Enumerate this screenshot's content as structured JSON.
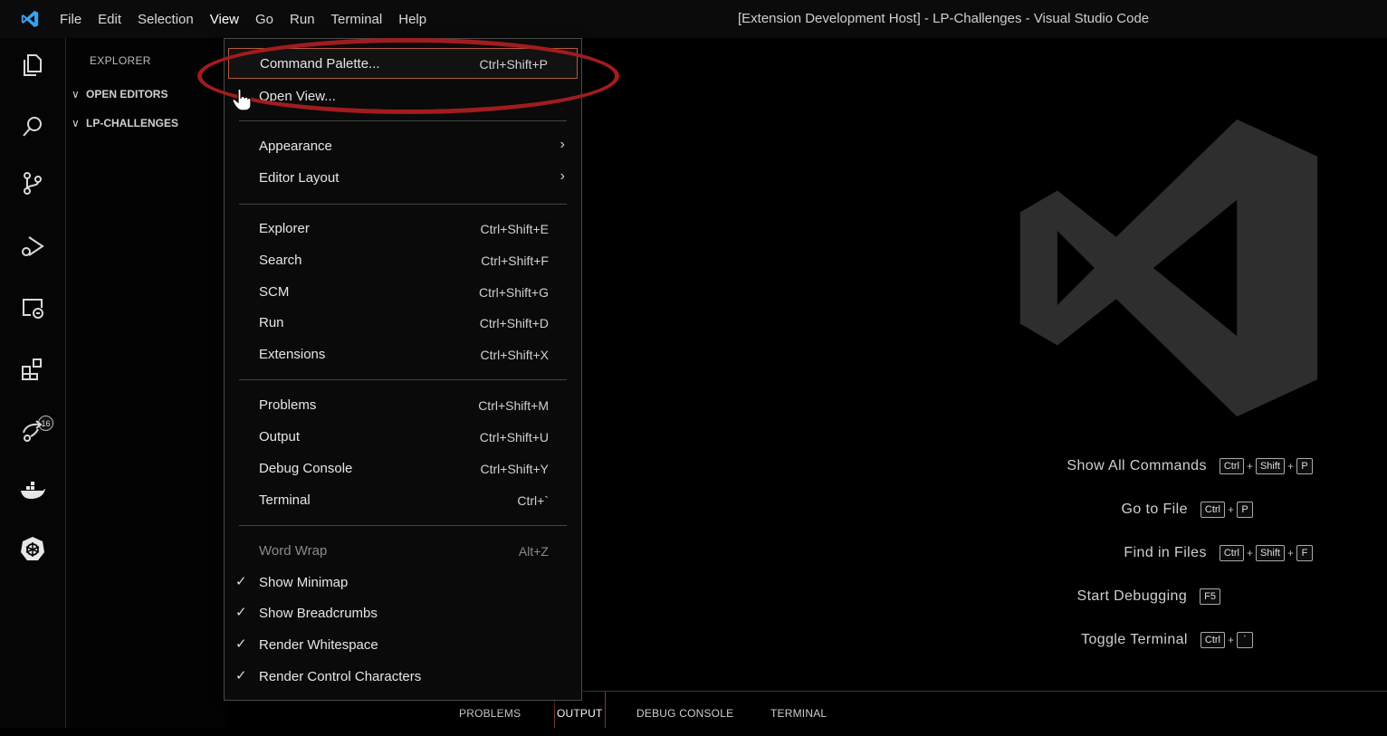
{
  "window": {
    "title": "[Extension Development Host] - LP-Challenges - Visual Studio Code"
  },
  "menubar": {
    "items": [
      "File",
      "Edit",
      "Selection",
      "View",
      "Go",
      "Run",
      "Terminal",
      "Help"
    ]
  },
  "activity_bar": {
    "icons": [
      "explorer-icon",
      "search-icon",
      "source-control-icon",
      "run-debug-icon",
      "remote-explorer-icon",
      "extensions-icon",
      "live-share-icon",
      "docker-icon",
      "kubernetes-icon"
    ],
    "extensions_badge": "16"
  },
  "sidebar": {
    "title": "EXPLORER",
    "sections": [
      "OPEN EDITORS",
      "LP-CHALLENGES"
    ]
  },
  "view_menu": {
    "command_palette": {
      "label": "Command Palette...",
      "key": "Ctrl+Shift+P"
    },
    "open_view": {
      "label": "Open View..."
    },
    "appearance": {
      "label": "Appearance"
    },
    "editor_layout": {
      "label": "Editor Layout"
    },
    "explorer": {
      "label": "Explorer",
      "key": "Ctrl+Shift+E"
    },
    "search": {
      "label": "Search",
      "key": "Ctrl+Shift+F"
    },
    "scm": {
      "label": "SCM",
      "key": "Ctrl+Shift+G"
    },
    "run": {
      "label": "Run",
      "key": "Ctrl+Shift+D"
    },
    "extensions": {
      "label": "Extensions",
      "key": "Ctrl+Shift+X"
    },
    "problems": {
      "label": "Problems",
      "key": "Ctrl+Shift+M"
    },
    "output": {
      "label": "Output",
      "key": "Ctrl+Shift+U"
    },
    "debug_console": {
      "label": "Debug Console",
      "key": "Ctrl+Shift+Y"
    },
    "terminal": {
      "label": "Terminal",
      "key": "Ctrl+`"
    },
    "word_wrap": {
      "label": "Word Wrap",
      "key": "Alt+Z"
    },
    "show_minimap": {
      "label": "Show Minimap",
      "checked": true
    },
    "show_breadcrumbs": {
      "label": "Show Breadcrumbs",
      "checked": true
    },
    "render_whitespace": {
      "label": "Render Whitespace",
      "checked": true
    },
    "render_control_characters": {
      "label": "Render Control Characters",
      "checked": true
    },
    "check_glyph": "✓",
    "submenu_glyph": "›"
  },
  "welcome_shortcuts": {
    "show_all_commands": {
      "label": "Show All Commands",
      "keys": [
        "Ctrl",
        "Shift",
        "P"
      ]
    },
    "go_to_file": {
      "label": "Go to File",
      "keys": [
        "Ctrl",
        "P"
      ]
    },
    "find_in_files": {
      "label": "Find in Files",
      "keys": [
        "Ctrl",
        "Shift",
        "F"
      ]
    },
    "start_debugging": {
      "label": "Start Debugging",
      "keys": [
        "F5"
      ]
    },
    "toggle_terminal": {
      "label": "Toggle Terminal",
      "keys": [
        "Ctrl",
        "`"
      ]
    },
    "plus": "+"
  },
  "panel": {
    "tabs": [
      "PROBLEMS",
      "OUTPUT",
      "DEBUG CONSOLE",
      "TERMINAL"
    ],
    "active_tab": "OUTPUT"
  },
  "colors": {
    "annotation_ellipse": "#a11c1e",
    "menu_highlight_border": "#b35a3a",
    "background": "#000000"
  }
}
